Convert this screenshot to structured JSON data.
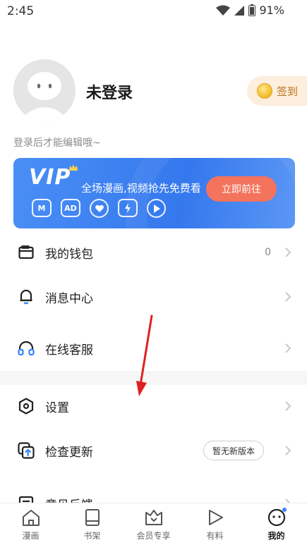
{
  "status_bar": {
    "time": "2:45",
    "battery": "91%"
  },
  "profile": {
    "username": "未登录",
    "checkin_label": "签到",
    "hint": "登录后才能编辑哦~"
  },
  "vip_banner": {
    "logo": "VIP",
    "slogan": "全场漫画,视频抢先免费看",
    "button": "立即前往",
    "icons": [
      "M",
      "AD"
    ]
  },
  "menu": {
    "wallet": {
      "label": "我的钱包",
      "value": "0"
    },
    "messages": {
      "label": "消息中心"
    },
    "support": {
      "label": "在线客服"
    },
    "settings": {
      "label": "设置"
    },
    "update": {
      "label": "检查更新",
      "badge": "暂无新版本"
    },
    "feedback": {
      "label": "意见反馈"
    }
  },
  "tab_bar": {
    "tabs": [
      {
        "label": "漫画",
        "icon": "home-icon"
      },
      {
        "label": "书架",
        "icon": "bookshelf-icon"
      },
      {
        "label": "会员专享",
        "icon": "vip-crown-icon"
      },
      {
        "label": "有料",
        "icon": "play-icon"
      },
      {
        "label": "我的",
        "icon": "profile-face-icon"
      }
    ],
    "active": "我的"
  },
  "colors": {
    "vip_blue": "#3a80ef",
    "vip_button": "#f3735c",
    "checkin_bg": "#fdeedd",
    "annotation_arrow": "#e02020"
  }
}
